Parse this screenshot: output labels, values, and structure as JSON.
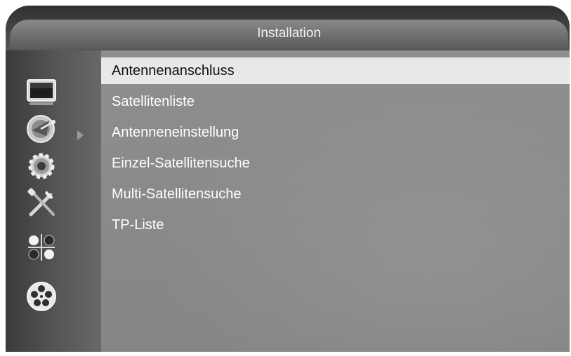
{
  "header": {
    "title": "Installation"
  },
  "sidebar": {
    "icons": [
      {
        "icon": "tv-icon",
        "selected": false
      },
      {
        "icon": "satellite-dish-icon",
        "selected": true
      },
      {
        "icon": "gear-icon",
        "selected": false
      },
      {
        "icon": "tools-icon",
        "selected": false
      },
      {
        "icon": "media-icon",
        "selected": false
      },
      {
        "icon": "film-reel-icon",
        "selected": false
      }
    ]
  },
  "menu": {
    "items": [
      {
        "label": "Antennenanschluss",
        "selected": true
      },
      {
        "label": "Satellitenliste",
        "selected": false
      },
      {
        "label": "Antenneneinstellung",
        "selected": false
      },
      {
        "label": "Einzel-Satellitensuche",
        "selected": false
      },
      {
        "label": "Multi-Satellitensuche",
        "selected": false
      },
      {
        "label": "TP-Liste",
        "selected": false
      }
    ]
  },
  "colors": {
    "highlight": "#e8e8e8",
    "text": "#ffffff",
    "selected_text": "#111111"
  }
}
